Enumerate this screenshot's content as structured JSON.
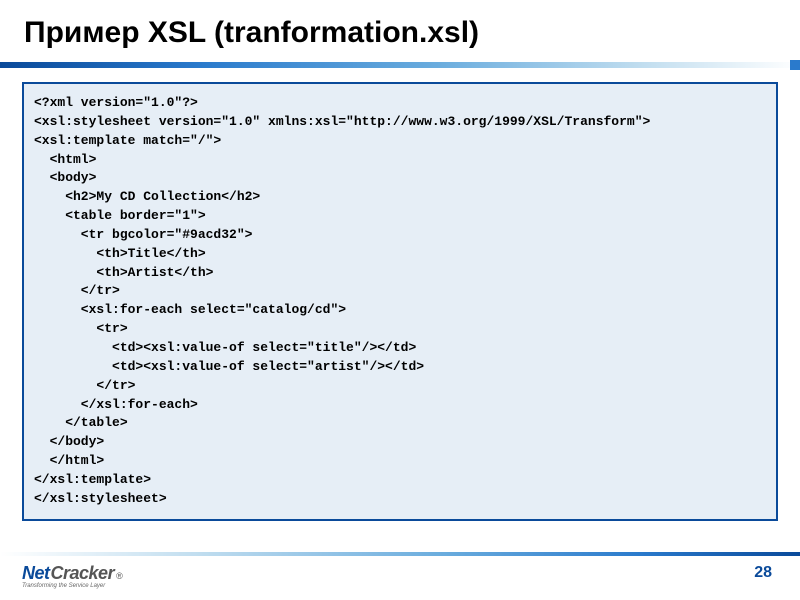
{
  "title": "Пример XSL (tranformation.xsl)",
  "code": {
    "l0": "<?xml version=\"1.0\"?>",
    "l1": "<xsl:stylesheet version=\"1.0\" xmlns:xsl=\"http://www.w3.org/1999/XSL/Transform\">",
    "l2": "<xsl:template match=\"/\">",
    "l3": "  <html>",
    "l4": "  <body>",
    "l5": "    <h2>My CD Collection</h2>",
    "l6": "    <table border=\"1\">",
    "l7": "      <tr bgcolor=\"#9acd32\">",
    "l8": "        <th>Title</th>",
    "l9": "        <th>Artist</th>",
    "l10": "      </tr>",
    "l11": "      <xsl:for-each select=\"catalog/cd\">",
    "l12": "        <tr>",
    "l13": "          <td><xsl:value-of select=\"title\"/></td>",
    "l14": "          <td><xsl:value-of select=\"artist\"/></td>",
    "l15": "        </tr>",
    "l16": "      </xsl:for-each>",
    "l17": "    </table>",
    "l18": "  </body>",
    "l19": "  </html>",
    "l20": "</xsl:template>",
    "l21": "</xsl:stylesheet>"
  },
  "footer": {
    "logo_net": "Net",
    "logo_cracker": "Cracker",
    "logo_reg": "®",
    "tagline": "Transforming the Service Layer",
    "page": "28"
  }
}
